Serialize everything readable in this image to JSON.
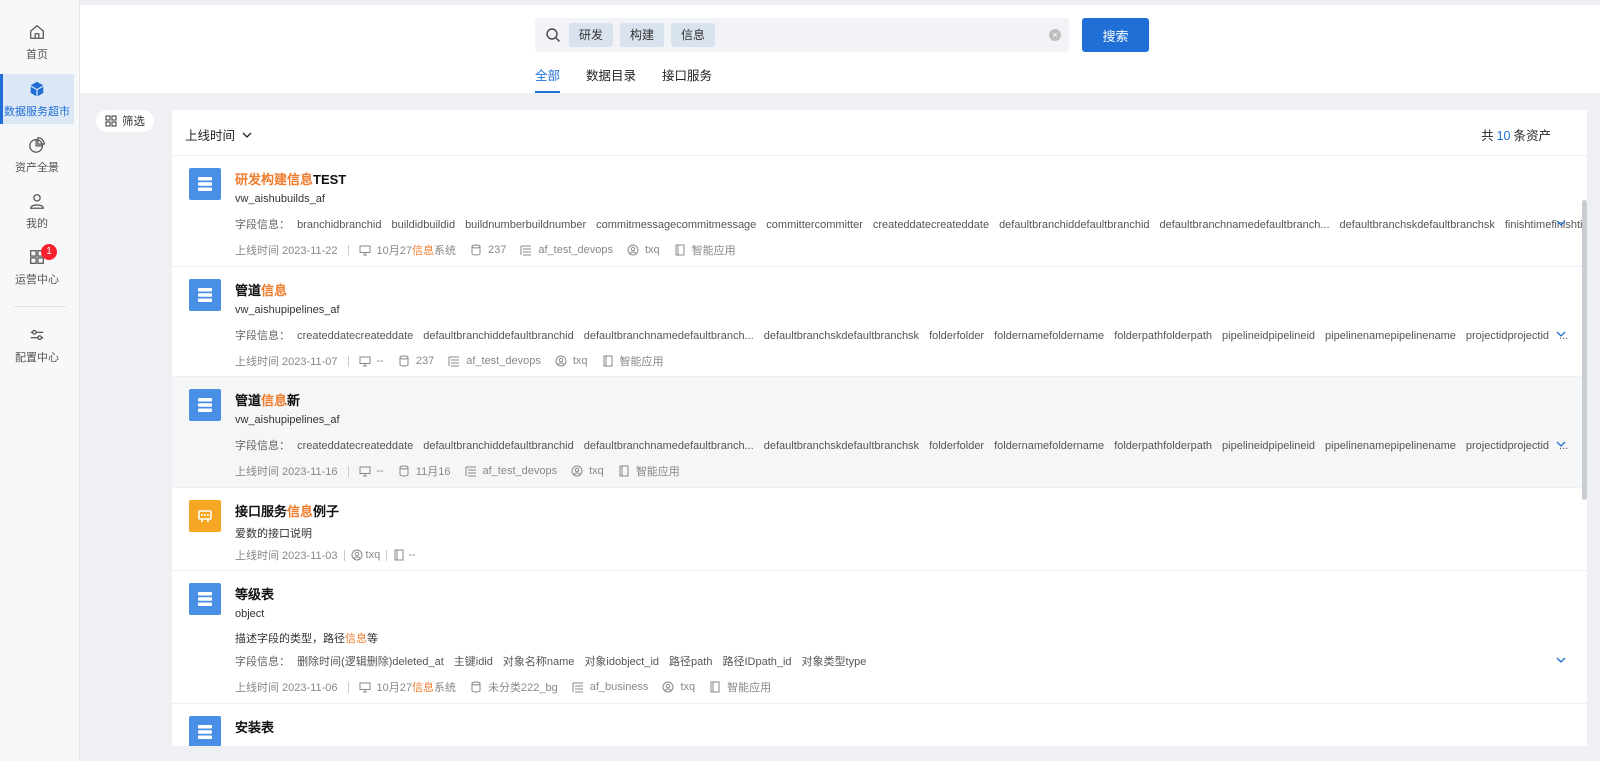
{
  "sidebar": {
    "items": [
      {
        "label": "首页",
        "icon": "home-icon"
      },
      {
        "label": "数据服务超市",
        "icon": "cube-icon",
        "active": true
      },
      {
        "label": "资产全景",
        "icon": "pie-chart-icon"
      },
      {
        "label": "我的",
        "icon": "user-icon"
      },
      {
        "label": "运营中心",
        "icon": "apps-grid-icon",
        "badge": "1"
      },
      {
        "label": "配置中心",
        "icon": "sliders-icon"
      }
    ]
  },
  "search": {
    "tags": [
      "研发",
      "构建",
      "信息"
    ],
    "button_label": "搜索"
  },
  "tabs": [
    {
      "label": "全部",
      "active": true
    },
    {
      "label": "数据目录",
      "active": false
    },
    {
      "label": "接口服务",
      "active": false
    }
  ],
  "filter": {
    "label": "筛选"
  },
  "list_header": {
    "sort_label": "上线时间",
    "total_prefix": "共",
    "total_count": "10",
    "total_suffix": "条资产"
  },
  "labels": {
    "fields": "字段信息："
  },
  "items": [
    {
      "title_hit": "研发构建信息",
      "title_rest": "TEST",
      "subtitle": "vw_aishubuilds_af",
      "fields": [
        "branchidbranchid",
        "buildidbuildid",
        "buildnumberbuildnumber",
        "commitmessagecommitmessage",
        "committercommitter",
        "createddatecreateddate",
        "defaultbranchiddefaultbranchid",
        "defaultbranchnamedefaultbranch...",
        "defaultbranchskdefaultbranchsk",
        "finishtimefinishtime"
      ],
      "more": "...",
      "online": "上线时间 2023-11-22",
      "system_pre": "10月27",
      "system_hit": "信息",
      "system_post": "系统",
      "db": "237",
      "table": "af_test_devops",
      "owner": "txq",
      "app": "智能应用"
    },
    {
      "title_pre": "管道",
      "title_hit": "信息",
      "subtitle": "vw_aishupipelines_af",
      "fields": [
        "createddatecreateddate",
        "defaultbranchiddefaultbranchid",
        "defaultbranchnamedefaultbranch...",
        "defaultbranchskdefaultbranchsk",
        "folderfolder",
        "foldernamefoldername",
        "folderpathfolderpath",
        "pipelineidpipelineid",
        "pipelinenamepipelinename",
        "projectidprojectid"
      ],
      "more": "...",
      "online": "上线时间 2023-11-07",
      "system": "--",
      "db": "237",
      "table": "af_test_devops",
      "owner": "txq",
      "app": "智能应用"
    },
    {
      "title_pre": "管道",
      "title_hit": "信息",
      "title_rest": "新",
      "subtitle": "vw_aishupipelines_af",
      "fields": [
        "createddatecreateddate",
        "defaultbranchiddefaultbranchid",
        "defaultbranchnamedefaultbranch...",
        "defaultbranchskdefaultbranchsk",
        "folderfolder",
        "foldernamefoldername",
        "folderpathfolderpath",
        "pipelineidpipelineid",
        "pipelinenamepipelinename",
        "projectidprojectid"
      ],
      "more": "...",
      "online": "上线时间 2023-11-16",
      "system": "--",
      "db": "11月16",
      "table": "af_test_devops",
      "owner": "txq",
      "app": "智能应用"
    },
    {
      "title_pre": "接口服务",
      "title_hit": "信息",
      "title_rest": "例子",
      "subtitle": "爱数的接口说明",
      "online": "上线时间 2023-11-03",
      "owner": "txq",
      "app": "--"
    },
    {
      "title_rest": "等级表",
      "subtitle": "object",
      "desc_pre": "描述字段的类型，路径",
      "desc_hit": "信息",
      "desc_post": "等",
      "fields": [
        "删除时间(逻辑删除)deleted_at",
        "主键idid",
        "对象名称name",
        "对象idobject_id",
        "路径path",
        "路径IDpath_id",
        "对象类型type"
      ],
      "online": "上线时间 2023-11-06",
      "system_pre": "10月27",
      "system_hit": "信息",
      "system_post": "系统",
      "db": "未分类222_bg",
      "table": "af_business",
      "owner": "txq",
      "app": "智能应用"
    },
    {
      "title_rest": "安装表"
    }
  ]
}
